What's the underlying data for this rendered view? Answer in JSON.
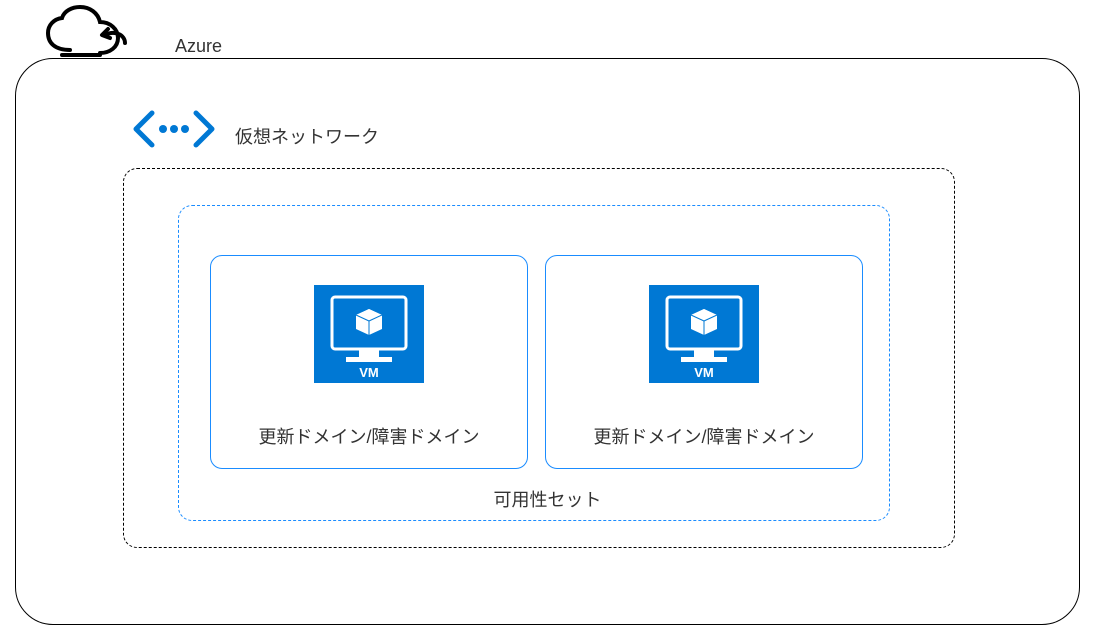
{
  "azure": {
    "label": "Azure"
  },
  "vnet": {
    "label": "仮想ネットワーク"
  },
  "availability_set": {
    "label": "可用性セット"
  },
  "domains": [
    {
      "label": "更新ドメイン/障害ドメイン"
    },
    {
      "label": "更新ドメイン/障害ドメイン"
    }
  ],
  "icons": {
    "cloud": "cloud-icon",
    "vnet": "vnet-icon",
    "vm": "vm-icon"
  },
  "colors": {
    "azure_blue": "#0078d4",
    "border_blue": "#1a8cff",
    "black": "#000000"
  }
}
